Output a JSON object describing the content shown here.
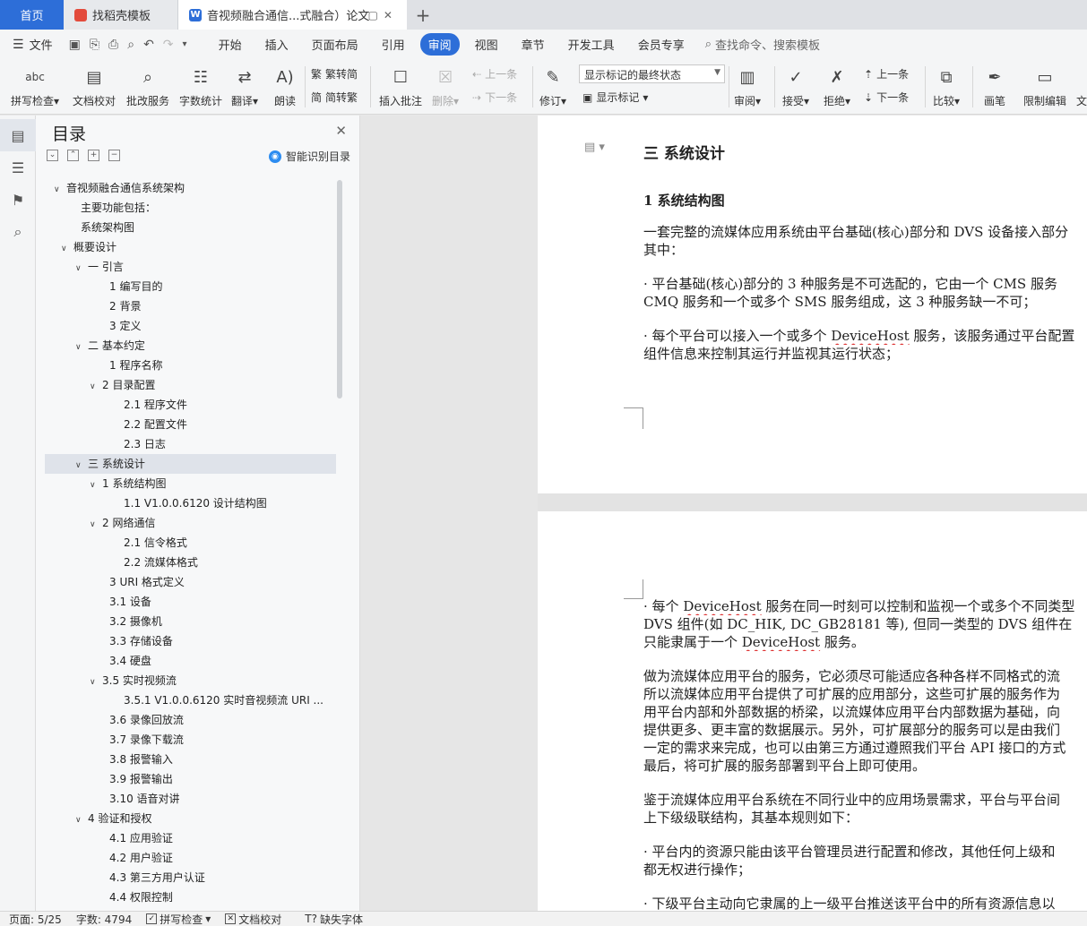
{
  "tabs": {
    "home": "首页",
    "template": "找稻壳模板",
    "document": "音视频融合通信...式融合）论文"
  },
  "menu": {
    "file": "文件",
    "items": [
      "开始",
      "插入",
      "页面布局",
      "引用",
      "审阅",
      "视图",
      "章节",
      "开发工具",
      "会员专享"
    ],
    "active_index": 4,
    "search_placeholder": "查找命令、搜索模板"
  },
  "ribbon": {
    "spellcheck": "拼写检查",
    "doccheck": "文档校对",
    "batch": "批改服务",
    "wordcount": "字数统计",
    "translate": "翻译",
    "read": "朗读",
    "to_traditional": "繁转简",
    "to_simplified": "简转繁",
    "insert_comment": "插入批注",
    "delete": "删除",
    "prev_comment": "上一条",
    "next_comment": "下一条",
    "track": "修订",
    "markup_state": "显示标记的最终状态",
    "show_markup": "显示标记",
    "review": "审阅",
    "accept": "接受",
    "reject": "拒绝",
    "prev_change": "上一条",
    "next_change": "下一条",
    "compare": "比较",
    "pen": "画笔",
    "restrict": "限制编辑",
    "more": "文",
    "abc": "abc"
  },
  "toc": {
    "title": "目录",
    "smart": "智能识别目录",
    "items": [
      {
        "label": "音视频融合通信系统架构",
        "level": 0,
        "chev": true,
        "active": false
      },
      {
        "label": "主要功能包括：",
        "level": 1,
        "chev": false,
        "active": false
      },
      {
        "label": "系统架构图",
        "level": 1,
        "chev": false,
        "active": false
      },
      {
        "label": "概要设计",
        "level": 0.5,
        "chev": true,
        "active": false
      },
      {
        "label": "一 引言",
        "level": 1.5,
        "chev": true,
        "active": false
      },
      {
        "label": "1 编写目的",
        "level": 3,
        "chev": false,
        "active": false
      },
      {
        "label": "2 背景",
        "level": 3,
        "chev": false,
        "active": false
      },
      {
        "label": "3 定义",
        "level": 3,
        "chev": false,
        "active": false
      },
      {
        "label": "二 基本约定",
        "level": 1.5,
        "chev": true,
        "active": false
      },
      {
        "label": "1 程序名称",
        "level": 3,
        "chev": false,
        "active": false
      },
      {
        "label": "2 目录配置",
        "level": 2.5,
        "chev": true,
        "active": false
      },
      {
        "label": "2.1 程序文件",
        "level": 4,
        "chev": false,
        "active": false
      },
      {
        "label": "2.2 配置文件",
        "level": 4,
        "chev": false,
        "active": false
      },
      {
        "label": "2.3 日志",
        "level": 4,
        "chev": false,
        "active": false
      },
      {
        "label": "三 系统设计",
        "level": 1.5,
        "chev": true,
        "active": true
      },
      {
        "label": "1 系统结构图",
        "level": 2.5,
        "chev": true,
        "active": false
      },
      {
        "label": "1.1 V1.0.0.6120 设计结构图",
        "level": 4,
        "chev": false,
        "active": false
      },
      {
        "label": "2 网络通信",
        "level": 2.5,
        "chev": true,
        "active": false
      },
      {
        "label": "2.1 信令格式",
        "level": 4,
        "chev": false,
        "active": false
      },
      {
        "label": "2.2 流媒体格式",
        "level": 4,
        "chev": false,
        "active": false
      },
      {
        "label": "3 URI 格式定义",
        "level": 3,
        "chev": false,
        "active": false
      },
      {
        "label": "3.1 设备",
        "level": 3,
        "chev": false,
        "active": false
      },
      {
        "label": "3.2 摄像机",
        "level": 3,
        "chev": false,
        "active": false
      },
      {
        "label": "3.3 存储设备",
        "level": 3,
        "chev": false,
        "active": false
      },
      {
        "label": "3.4 硬盘",
        "level": 3,
        "chev": false,
        "active": false
      },
      {
        "label": "3.5 实时视频流",
        "level": 2.5,
        "chev": true,
        "active": false
      },
      {
        "label": "3.5.1 V1.0.0.6120 实时音视频流 URI ...",
        "level": 4,
        "chev": false,
        "active": false
      },
      {
        "label": "3.6 录像回放流",
        "level": 3,
        "chev": false,
        "active": false
      },
      {
        "label": "3.7 录像下载流",
        "level": 3,
        "chev": false,
        "active": false
      },
      {
        "label": "3.8 报警输入",
        "level": 3,
        "chev": false,
        "active": false
      },
      {
        "label": "3.9 报警输出",
        "level": 3,
        "chev": false,
        "active": false
      },
      {
        "label": "3.10 语音对讲",
        "level": 3,
        "chev": false,
        "active": false
      },
      {
        "label": "4 验证和授权",
        "level": 1.5,
        "chev": true,
        "active": false
      },
      {
        "label": "4.1 应用验证",
        "level": 3,
        "chev": false,
        "active": false
      },
      {
        "label": "4.2 用户验证",
        "level": 3,
        "chev": false,
        "active": false
      },
      {
        "label": "4.3 第三方用户认证",
        "level": 3,
        "chev": false,
        "active": false
      },
      {
        "label": "4.4 权限控制",
        "level": 3,
        "chev": false,
        "active": false
      }
    ]
  },
  "doc": {
    "heading": "三 系统设计",
    "subheading": "1 系统结构图",
    "p1_l1": "一套完整的流媒体应用系统由平台基础(核心)部分和 DVS 设备接入部分",
    "p1_l2": "其中：",
    "p2_l1": "· 平台基础(核心)部分的 3 种服务是不可选配的，它由一个 CMS 服务",
    "p2_l2": "CMQ 服务和一个或多个 SMS 服务组成，这 3 种服务缺一不可；",
    "p3_l1a": "· 每个平台可以接入一个或多个 ",
    "p3_l1w": "DeviceHost",
    "p3_l1b": " 服务，该服务通过平台配置",
    "p3_l2": "组件信息来控制其运行并监视其运行状态；",
    "q1_l1a": "· 每个 ",
    "q1_l1w": "DeviceHost",
    "q1_l1b": " 服务在同一时刻可以控制和监视一个或多个不同类型",
    "q1_l2": "DVS 组件(如 DC_HIK, DC_GB28181 等), 但同一类型的 DVS 组件在",
    "q1_l3a": "只能隶属于一个 ",
    "q1_l3w": "DeviceHost",
    "q1_l3b": " 服务。",
    "q2_l1": "做为流媒体应用平台的服务，它必须尽可能适应各种各样不同格式的流",
    "q2_l2": "所以流媒体应用平台提供了可扩展的应用部分，这些可扩展的服务作为",
    "q2_l3": "用平台内部和外部数据的桥梁，以流媒体应用平台内部数据为基础，向",
    "q2_l4": "提供更多、更丰富的数据展示。另外，可扩展部分的服务可以是由我们",
    "q2_l5": "一定的需求来完成，也可以由第三方通过遵照我们平台 API 接口的方式",
    "q2_l6": "最后，将可扩展的服务部署到平台上即可使用。",
    "q3_l1": "鉴于流媒体应用平台系统在不同行业中的应用场景需求，平台与平台间",
    "q3_l2": "上下级级联结构，其基本规则如下：",
    "q4_l1": "· 平台内的资源只能由该平台管理员进行配置和修改，其他任何上级和",
    "q4_l2": "都无权进行操作；",
    "q5_l1": "· 下级平台主动向它隶属的上一级平台推送该平台中的所有资源信息以"
  },
  "status": {
    "page": "页面: 5/25",
    "words": "字数: 4794",
    "spell": "拼写检查",
    "proof": "文档校对",
    "font": "缺失字体"
  }
}
